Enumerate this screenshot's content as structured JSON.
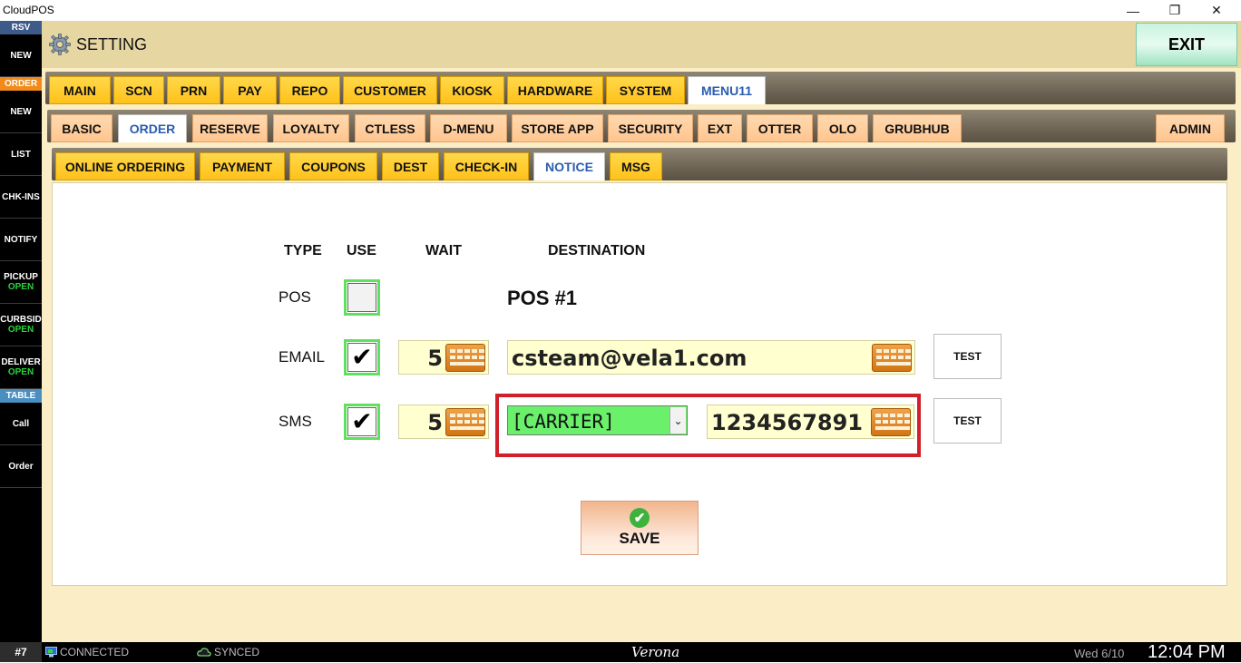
{
  "window": {
    "title": "CloudPOS",
    "minimize": "—",
    "restore": "❐",
    "close": "✕"
  },
  "sidebar": {
    "rsv_header": "RSV",
    "new_rsv": "NEW",
    "order_header": "ORDER",
    "new_order": "NEW",
    "list": "LIST",
    "chk_ins": "CHK-INS",
    "notify": "NOTIFY",
    "pickup": "PICKUP",
    "pickup_status": "OPEN",
    "curbside": "CURBSID",
    "curbside_status": "OPEN",
    "delivery": "DELIVER",
    "delivery_status": "OPEN",
    "table_header": "TABLE",
    "call": "Call",
    "order": "Order",
    "colors": {
      "rsv": "#3c5a8a",
      "order": "#f08a1a",
      "table": "#4a8fc2",
      "open": "#27d33a"
    }
  },
  "header": {
    "title": "SETTING",
    "exit": "EXIT"
  },
  "tabs_main": [
    "MAIN",
    "SCN",
    "PRN",
    "PAY",
    "REPO",
    "CUSTOMER",
    "KIOSK",
    "HARDWARE",
    "SYSTEM",
    "MENU11"
  ],
  "tabs_sub": [
    "BASIC",
    "ORDER",
    "RESERVE",
    "LOYALTY",
    "CTLESS",
    "D-MENU",
    "STORE APP",
    "SECURITY",
    "EXT",
    "OTTER",
    "OLO",
    "GRUBHUB",
    "ADMIN"
  ],
  "tabs_third": [
    "ONLINE ORDERING",
    "PAYMENT",
    "COUPONS",
    "DEST",
    "CHECK-IN",
    "NOTICE",
    "MSG"
  ],
  "notice": {
    "headers": {
      "type": "TYPE",
      "use": "USE",
      "wait": "WAIT",
      "destination": "DESTINATION"
    },
    "pos": {
      "label": "POS",
      "use": false,
      "destination": "POS #1"
    },
    "email": {
      "label": "EMAIL",
      "use": true,
      "check": "✔",
      "wait": "5",
      "destination": "csteam@vela1.com",
      "test": "TEST"
    },
    "sms": {
      "label": "SMS",
      "use": true,
      "check": "✔",
      "wait": "5",
      "carrier": "[CARRIER]",
      "arrow": "⌄",
      "phone": "1234567891",
      "test": "TEST"
    },
    "save": {
      "icon": "✔",
      "label": "SAVE"
    }
  },
  "status": {
    "terminal": "#7",
    "connected": "CONNECTED",
    "synced": "SYNCED",
    "store": "Verona",
    "date": "Wed 6/10",
    "time": "12:04 PM"
  }
}
